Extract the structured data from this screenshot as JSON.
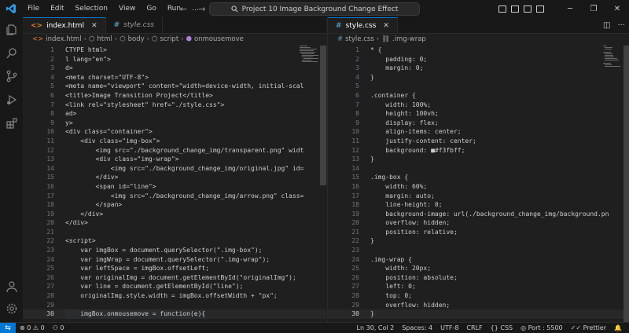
{
  "menu": [
    "File",
    "Edit",
    "Selection",
    "View",
    "Go",
    "Run",
    "..."
  ],
  "search": {
    "label": "Project 10 Image Background Change Effect"
  },
  "left_tabs": [
    {
      "label": "index.html",
      "icon": "html-file-icon",
      "active": true
    },
    {
      "label": "style.css",
      "icon": "css-file-icon",
      "active": false
    }
  ],
  "right_tabs": [
    {
      "label": "style.css",
      "icon": "css-file-icon",
      "active": true
    }
  ],
  "left_breadcrumb": [
    "index.html",
    "html",
    "body",
    "script",
    "onmousemove"
  ],
  "right_breadcrumb": [
    "style.css",
    ".img-wrap"
  ],
  "left_code": [
    {
      "n": "1",
      "t": "CTYPE html>"
    },
    {
      "n": "2",
      "t": "l lang=\"en\">"
    },
    {
      "n": "3",
      "t": "d>"
    },
    {
      "n": "4",
      "t": "<meta charset=\"UTF-8\">"
    },
    {
      "n": "5",
      "t": "<meta name=\"viewport\" content=\"width=device-width, initial-scal"
    },
    {
      "n": "6",
      "t": "<title>Image Transition Project</title>"
    },
    {
      "n": "7",
      "t": "<link rel=\"stylesheet\" href=\"./style.css\">"
    },
    {
      "n": "8",
      "t": "ad>"
    },
    {
      "n": "9",
      "t": "y>"
    },
    {
      "n": "10",
      "t": "<div class=\"container\">"
    },
    {
      "n": "11",
      "t": "    <div class=\"img-box\">"
    },
    {
      "n": "12",
      "t": "        <img src=\"./background_change_img/transparent.png\" widt"
    },
    {
      "n": "13",
      "t": "        <div class=\"img-wrap\">"
    },
    {
      "n": "14",
      "t": "            <img src=\"./background_change_img/original.jpg\" id="
    },
    {
      "n": "15",
      "t": "        </div>"
    },
    {
      "n": "16",
      "t": "        <span id=\"line\">"
    },
    {
      "n": "17",
      "t": "            <img src=\"./background_change_img/arrow.png\" class="
    },
    {
      "n": "18",
      "t": "        </span>"
    },
    {
      "n": "19",
      "t": "    </div>"
    },
    {
      "n": "20",
      "t": "</div>"
    },
    {
      "n": "21",
      "t": ""
    },
    {
      "n": "22",
      "t": "<script>"
    },
    {
      "n": "23",
      "t": "    var imgBox = document.querySelector(\".img-box\");"
    },
    {
      "n": "24",
      "t": "    var imgWrap = document.querySelector(\".img-wrap\");"
    },
    {
      "n": "25",
      "t": "    var leftSpace = imgBox.offsetLeft;"
    },
    {
      "n": "26",
      "t": "    var originalImg = document.getElementById(\"originalImg\");"
    },
    {
      "n": "27",
      "t": "    var line = document.getElementById(\"line\");"
    },
    {
      "n": "28",
      "t": "    originalImg.style.width = imgBox.offsetWidth + \"px\";"
    },
    {
      "n": "29",
      "t": ""
    },
    {
      "n": "30",
      "t": "    imgBox.onmousemove = function(e){"
    }
  ],
  "right_code": [
    {
      "n": "1",
      "t": "* {"
    },
    {
      "n": "2",
      "t": "    padding: 0;"
    },
    {
      "n": "3",
      "t": "    margin: 0;"
    },
    {
      "n": "4",
      "t": "}"
    },
    {
      "n": "5",
      "t": ""
    },
    {
      "n": "6",
      "t": ".container {"
    },
    {
      "n": "7",
      "t": "    width: 100%;"
    },
    {
      "n": "8",
      "t": "    height: 100vh;"
    },
    {
      "n": "9",
      "t": "    display: flex;"
    },
    {
      "n": "10",
      "t": "    align-items: center;"
    },
    {
      "n": "11",
      "t": "    justify-content: center;"
    },
    {
      "n": "12",
      "t": "    background: ■#f3fbff;"
    },
    {
      "n": "13",
      "t": "}"
    },
    {
      "n": "14",
      "t": ""
    },
    {
      "n": "15",
      "t": ".img-box {"
    },
    {
      "n": "16",
      "t": "    width: 60%;"
    },
    {
      "n": "17",
      "t": "    margin: auto;"
    },
    {
      "n": "18",
      "t": "    line-height: 0;"
    },
    {
      "n": "19",
      "t": "    background-image: url(./background_change_img/background.pn"
    },
    {
      "n": "20",
      "t": "    overflow: hidden;"
    },
    {
      "n": "21",
      "t": "    position: relative;"
    },
    {
      "n": "22",
      "t": "}"
    },
    {
      "n": "23",
      "t": ""
    },
    {
      "n": "24",
      "t": ".img-wrap {"
    },
    {
      "n": "25",
      "t": "    width: 20px;"
    },
    {
      "n": "26",
      "t": "    position: absolute;"
    },
    {
      "n": "27",
      "t": "    left: 0;"
    },
    {
      "n": "28",
      "t": "    top: 0;"
    },
    {
      "n": "29",
      "t": "    overflow: hidden;"
    },
    {
      "n": "30",
      "t": "}"
    }
  ],
  "status": {
    "errors": "0",
    "warnings": "0",
    "ports": "0",
    "position": "Ln 30, Col 2",
    "spaces": "Spaces: 4",
    "encoding": "UTF-8",
    "eol": "CRLF",
    "language": "CSS",
    "port": "Port : 5500",
    "prettier": "Prettier"
  },
  "colors": {
    "accent": "#0078d4",
    "html_icon": "#e37933",
    "css_icon": "#519aba"
  }
}
